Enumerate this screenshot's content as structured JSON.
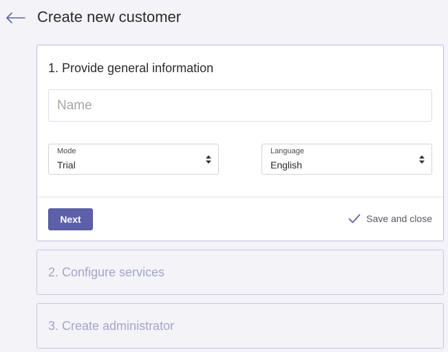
{
  "header": {
    "title": "Create new customer",
    "back_icon": "arrow-left-icon"
  },
  "colors": {
    "accent": "#5c60a8",
    "card_border": "#b9b9e2",
    "collapsed_text": "#a3a3cd",
    "background": "#f4f4f8"
  },
  "step1": {
    "title": "1. Provide general information",
    "name_input": {
      "placeholder": "Name",
      "value": ""
    },
    "mode": {
      "label": "Mode",
      "value": "Trial"
    },
    "language": {
      "label": "Language",
      "value": "English"
    },
    "next_label": "Next",
    "save_close_label": "Save and close",
    "save_close_icon": "checkmark-icon"
  },
  "step2": {
    "title": "2. Configure services"
  },
  "step3": {
    "title": "3. Create administrator"
  }
}
